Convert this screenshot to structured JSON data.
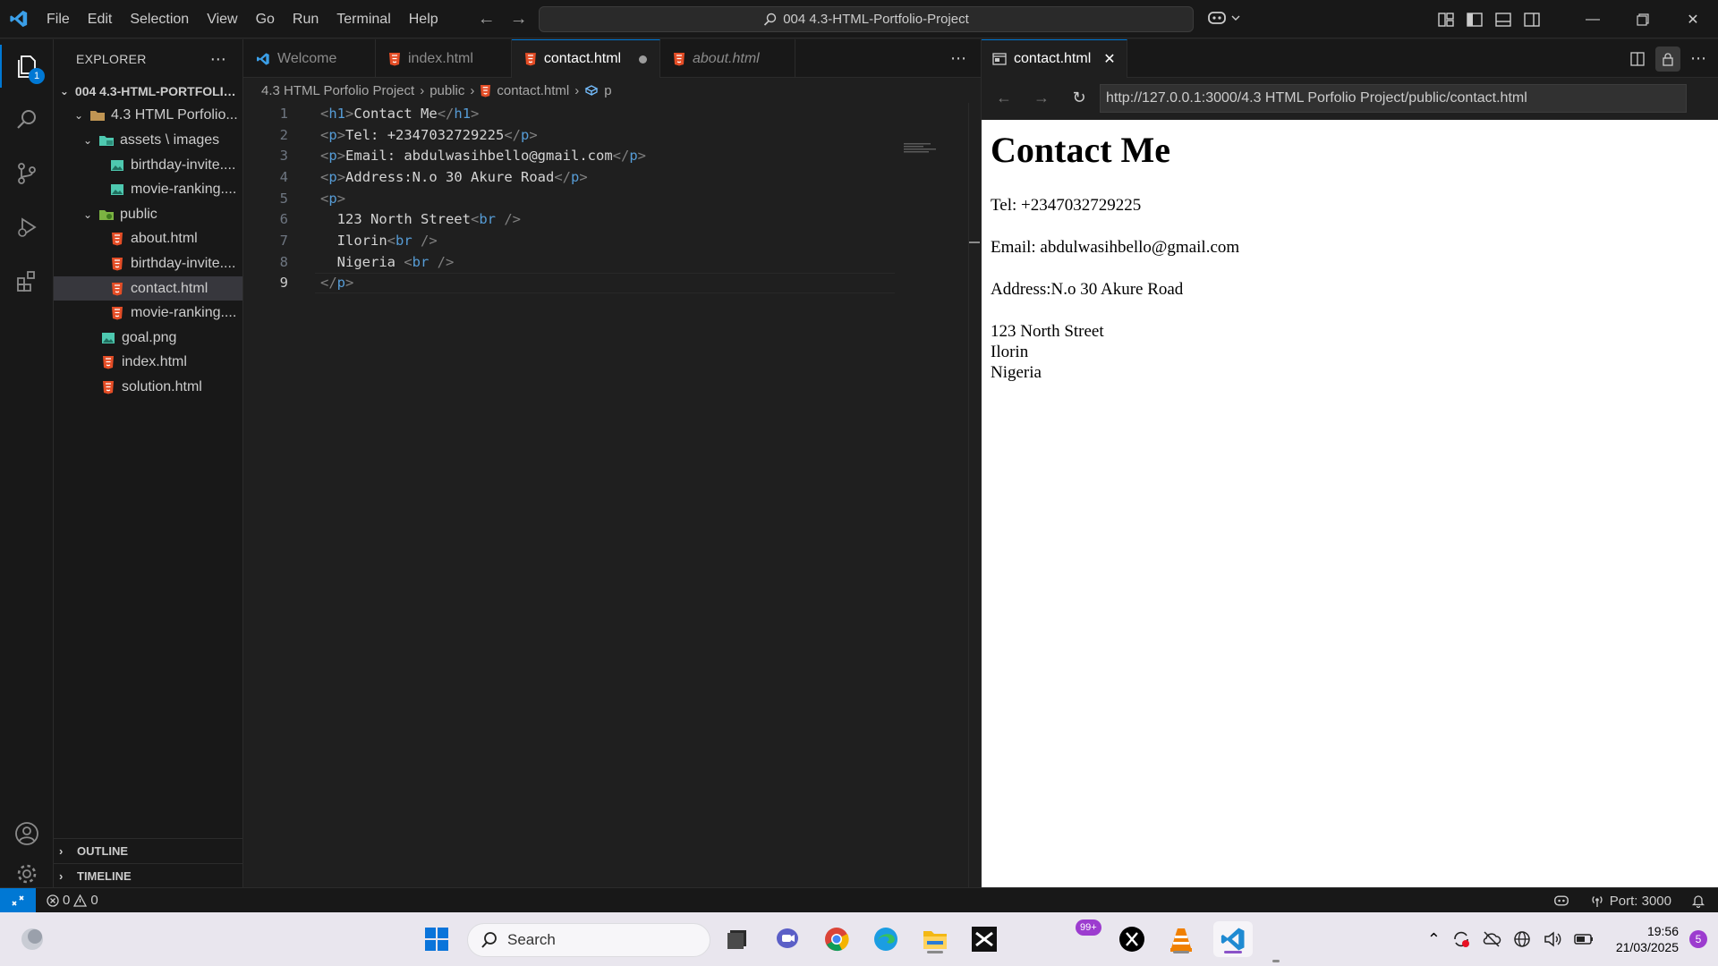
{
  "titlebar": {
    "menu": [
      "File",
      "Edit",
      "Selection",
      "View",
      "Go",
      "Run",
      "Terminal",
      "Help"
    ],
    "command_center": "004 4.3-HTML-Portfolio-Project"
  },
  "activity": {
    "explorer_badge": "1"
  },
  "sidebar": {
    "title": "EXPLORER",
    "root": "004 4.3-HTML-PORTFOLIO...",
    "folder_project": "4.3 HTML Porfolio...",
    "folder_assets": "assets \\ images",
    "assets_files": [
      "birthday-invite....",
      "movie-ranking...."
    ],
    "folder_public": "public",
    "public_files": [
      "about.html",
      "birthday-invite....",
      "contact.html",
      "movie-ranking...."
    ],
    "root_files": [
      "goal.png",
      "index.html",
      "solution.html"
    ],
    "outline": "OUTLINE",
    "timeline": "TIMELINE"
  },
  "editor": {
    "tabs": [
      {
        "label": "Welcome"
      },
      {
        "label": "index.html"
      },
      {
        "label": "contact.html"
      },
      {
        "label": "about.html"
      }
    ],
    "breadcrumb": [
      "4.3 HTML Porfolio Project",
      "public",
      "contact.html",
      "p"
    ],
    "line_numbers": [
      "1",
      "2",
      "3",
      "4",
      "5",
      "6",
      "7",
      "8",
      "9"
    ],
    "code": {
      "l1_text": "Contact Me",
      "l2_text": "Tel: +2347032729225",
      "l3_text": "Email: abdulwasihbello@gmail.com",
      "l4_text": "Address:N.o 30 Akure Road",
      "l6_text": "  123 North Street",
      "l7_text": "  Ilorin",
      "l8_text": "  Nigeria "
    }
  },
  "preview": {
    "tab_label": "contact.html",
    "url": "http://127.0.0.1:3000/4.3 HTML Porfolio Project/public/contact.html",
    "heading": "Contact Me",
    "tel": "Tel: +2347032729225",
    "email": "Email: abdulwasihbello@gmail.com",
    "address": "Address:N.o 30 Akure Road",
    "addr_line1": "123 North Street",
    "addr_line2": "Ilorin",
    "addr_line3": "Nigeria"
  },
  "statusbar": {
    "errors": "0",
    "warnings": "0",
    "port": "Port: 3000"
  },
  "taskbar": {
    "search_placeholder": "Search",
    "notif_badge": "99+",
    "time": "19:56",
    "date": "21/03/2025",
    "tray_badge": "5"
  },
  "colors": {
    "accent": "#0078d4",
    "html_icon": "#e44d26",
    "image_icon": "#4ec9b0"
  }
}
